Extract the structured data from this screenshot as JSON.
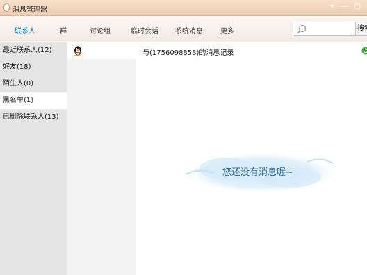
{
  "window": {
    "title": "消息管理器",
    "minimize_icon": "minimize-icon",
    "maximize_icon": "maximize-icon",
    "close_icon": "close-icon",
    "titlebar_color": "#eccdb2"
  },
  "tabs": [
    {
      "label": "联系人",
      "active": true
    },
    {
      "label": "群"
    },
    {
      "label": "讨论组"
    },
    {
      "label": "临时会话"
    },
    {
      "label": "系统消息"
    },
    {
      "label": "更多"
    }
  ],
  "search": {
    "placeholder": "",
    "button_label": "搜索"
  },
  "categories": [
    {
      "label": "最近联系人(12)"
    },
    {
      "label": "好友(18)"
    },
    {
      "label": "陌生人(0)"
    },
    {
      "label": "黑名单(1)",
      "active": true
    },
    {
      "label": "已删除联系人(13)"
    }
  ],
  "contact": {
    "icon": "qq-penguin-icon"
  },
  "record": {
    "title": "与(1756098858)的消息记录"
  },
  "empty": {
    "message": "您还没有消息喔~"
  },
  "colors": {
    "accent": "#1577c1",
    "empty_text": "#2e6fa5"
  }
}
